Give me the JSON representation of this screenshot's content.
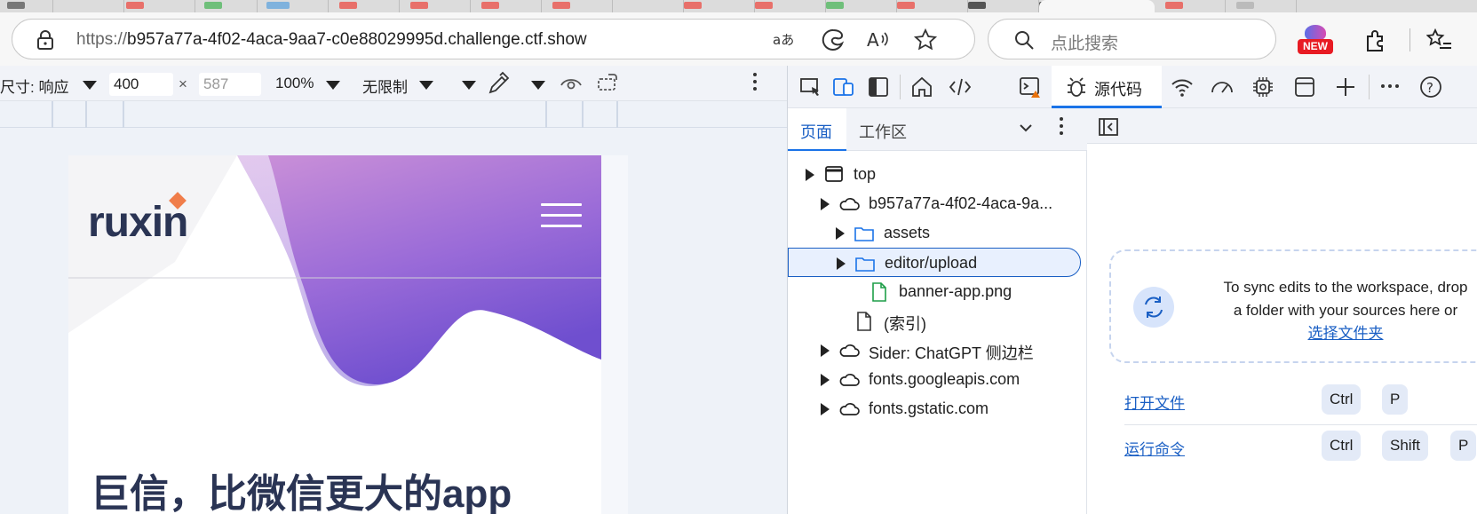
{
  "browser": {
    "url_scheme": "https://",
    "url_rest": "b957a77a-4f02-4aca-9aa7-c0e88029995d.challenge.ctf.show",
    "search_placeholder": "点此搜索",
    "new_badge": "NEW"
  },
  "device_toolbar": {
    "size_label": "尺寸: 响应",
    "width": "400",
    "times": "×",
    "height": "587",
    "zoom": "100%",
    "throttle": "无限制"
  },
  "page": {
    "logo": "ruxin",
    "hero_title": "巨信，比微信更大的app",
    "colors": {
      "accent": "#f07d4a",
      "purple": "#8e63d6",
      "text": "#2a3454"
    }
  },
  "devtools": {
    "active_tab": "源代码",
    "nav_tabs": {
      "page": "页面",
      "workspace": "工作区"
    },
    "tree": [
      {
        "label": "top",
        "indent": 0,
        "icon": "frame-icon",
        "expandable": true
      },
      {
        "label": "b957a77a-4f02-4aca-9a...",
        "indent": 1,
        "icon": "cloud-icon",
        "expandable": true
      },
      {
        "label": "assets",
        "indent": 2,
        "icon": "folder-icon",
        "expandable": true
      },
      {
        "label": "editor/upload",
        "indent": 2,
        "icon": "folder-icon",
        "expandable": true,
        "selected": true
      },
      {
        "label": "banner-app.png",
        "indent": 3,
        "icon": "file-icon-green",
        "expandable": false
      },
      {
        "label": "(索引)",
        "indent": 2,
        "icon": "file-icon",
        "expandable": false
      },
      {
        "label": "Sider: ChatGPT 侧边栏",
        "indent": 1,
        "icon": "cloud-icon",
        "expandable": true
      },
      {
        "label": "fonts.googleapis.com",
        "indent": 1,
        "icon": "cloud-icon",
        "expandable": true
      },
      {
        "label": "fonts.gstatic.com",
        "indent": 1,
        "icon": "cloud-icon",
        "expandable": true
      }
    ],
    "dropzone": {
      "line1": "To sync edits to the workspace, drop",
      "line2": "a folder with your sources here or",
      "link": "选择文件夹"
    },
    "shortcuts": [
      {
        "label": "打开文件",
        "keys": [
          "Ctrl",
          "P"
        ]
      },
      {
        "label": "运行命令",
        "keys": [
          "Ctrl",
          "Shift",
          "P"
        ]
      }
    ]
  }
}
